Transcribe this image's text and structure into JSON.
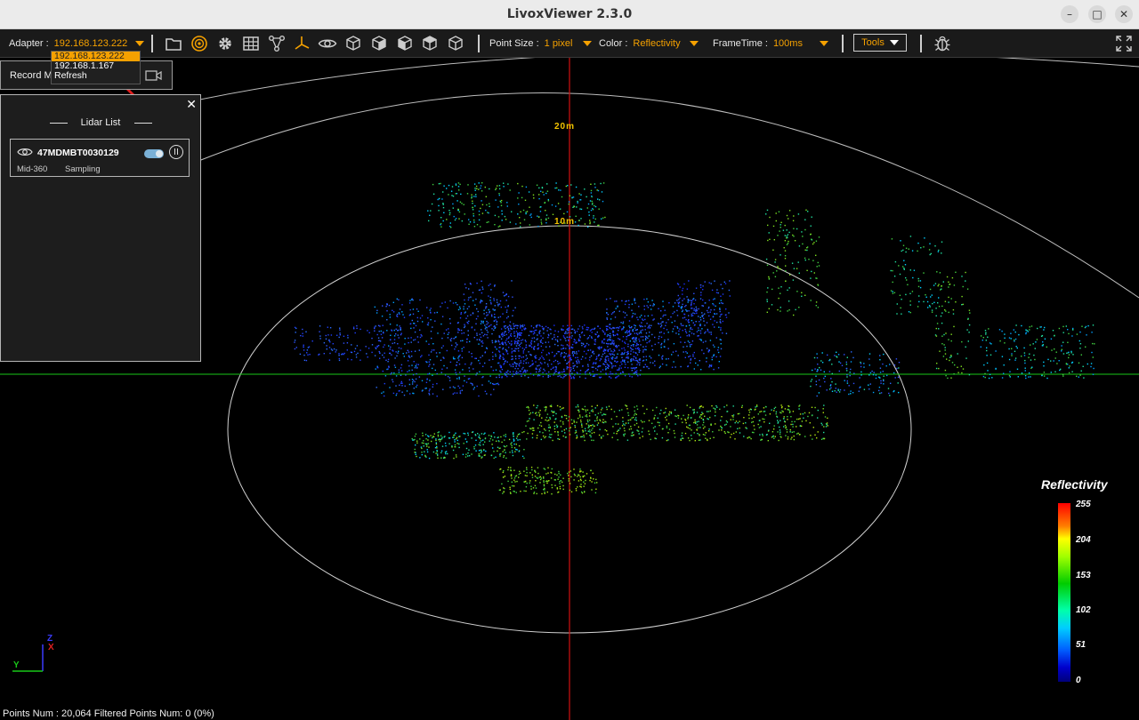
{
  "window": {
    "title": "LivoxViewer 2.3.0",
    "controls": [
      "minimize-icon",
      "maximize-icon",
      "close-icon"
    ]
  },
  "toolbar": {
    "adapter_label": "Adapter :",
    "adapter_value": "192.168.123.222",
    "point_size_label": "Point Size :",
    "point_size_value": "1 pixel",
    "color_label": "Color :",
    "color_value": "Reflectivity",
    "frametime_label": "FrameTime :",
    "frametime_value": "100ms",
    "tools_label": "Tools",
    "icons": [
      "folder-icon",
      "radar-icon",
      "gear-icon",
      "grid-table-icon",
      "network-icon",
      "axes-icon",
      "eye-icon",
      "cube-front-icon",
      "cube-side-icon",
      "cube-top-icon",
      "cube-iso-icon",
      "cube-all-icon",
      "bug-icon",
      "fullscreen-icon"
    ]
  },
  "adapter_dropdown": {
    "options": [
      "192.168.123.222",
      "192.168.1.167",
      "Refresh"
    ],
    "selected": "192.168.123.222"
  },
  "record_bar": {
    "label": "Record M"
  },
  "lidar_panel": {
    "title": "Lidar List",
    "devices": [
      {
        "serial": "47MDMBT0030129",
        "model": "Mid-360",
        "state": "Sampling",
        "enabled": true
      }
    ]
  },
  "scene": {
    "ring_labels": [
      "20m",
      "10m"
    ],
    "axis_labels": {
      "z": "Z",
      "x": "X",
      "y": "Y"
    }
  },
  "legend": {
    "title": "Reflectivity",
    "ticks": [
      "255",
      "204",
      "153",
      "102",
      "51",
      "0"
    ],
    "colors": [
      "#ff0000",
      "#ffff00",
      "#00cc00",
      "#00ccff",
      "#0000cc",
      "#00007a"
    ]
  },
  "status": {
    "text": "Points Num : 20,064  Filtered Points Num: 0 (0%)"
  },
  "colors": {
    "accent": "#f5a100",
    "background": "#000000",
    "toolbar_bg": "#1a1a1a"
  }
}
